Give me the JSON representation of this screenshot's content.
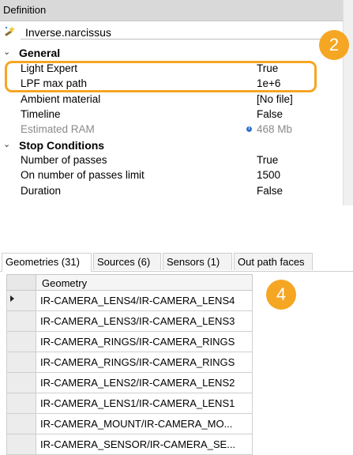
{
  "definition": {
    "header": "Definition",
    "object_name": "Inverse.narcissus",
    "categories": {
      "general": "General",
      "stop_conditions": "Stop Conditions"
    },
    "properties": [
      {
        "name": "Light Expert",
        "value": "True"
      },
      {
        "name": "LPF max path",
        "value": "1e+6"
      },
      {
        "name": "Ambient material",
        "value": "[No file]"
      },
      {
        "name": "Timeline",
        "value": "False"
      },
      {
        "name": "Estimated RAM",
        "value": "468 Mb"
      }
    ],
    "stop_properties": [
      {
        "name": "Number of passes",
        "value": "True"
      },
      {
        "name": "On number of passes limit",
        "value": "1500"
      },
      {
        "name": "Duration",
        "value": "False"
      }
    ],
    "info_glyph": "i",
    "icon": "simulation-wand-icon"
  },
  "callouts": {
    "top": "2",
    "bottom": "4"
  },
  "highlight_color": "#f5a623",
  "tabs": [
    {
      "label": "Geometries (31)"
    },
    {
      "label": "Sources (6)"
    },
    {
      "label": "Sensors (1)"
    },
    {
      "label": "Out path faces"
    }
  ],
  "grid": {
    "column_header": "Geometry",
    "rows": [
      "IR-CAMERA_LENS4/IR-CAMERA_LENS4",
      "IR-CAMERA_LENS3/IR-CAMERA_LENS3",
      "IR-CAMERA_RINGS/IR-CAMERA_RINGS",
      "IR-CAMERA_RINGS/IR-CAMERA_RINGS",
      "IR-CAMERA_LENS2/IR-CAMERA_LENS2",
      "IR-CAMERA_LENS1/IR-CAMERA_LENS1",
      "IR-CAMERA_MOUNT/IR-CAMERA_MO...",
      "IR-CAMERA_SENSOR/IR-CAMERA_SE..."
    ]
  }
}
